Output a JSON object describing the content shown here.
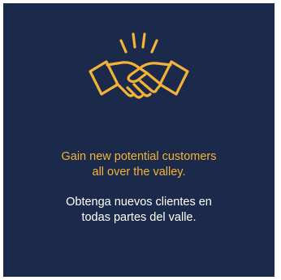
{
  "colors": {
    "background": "#1b2a4a",
    "accent": "#f3b339",
    "text": "#ffffff"
  },
  "icon": "handshake-icon",
  "headline": {
    "line1": "Gain new potential customers",
    "line2": "all over the valley."
  },
  "subline": {
    "line1": "Obtenga nuevos clientes en",
    "line2": "todas partes del valle."
  }
}
